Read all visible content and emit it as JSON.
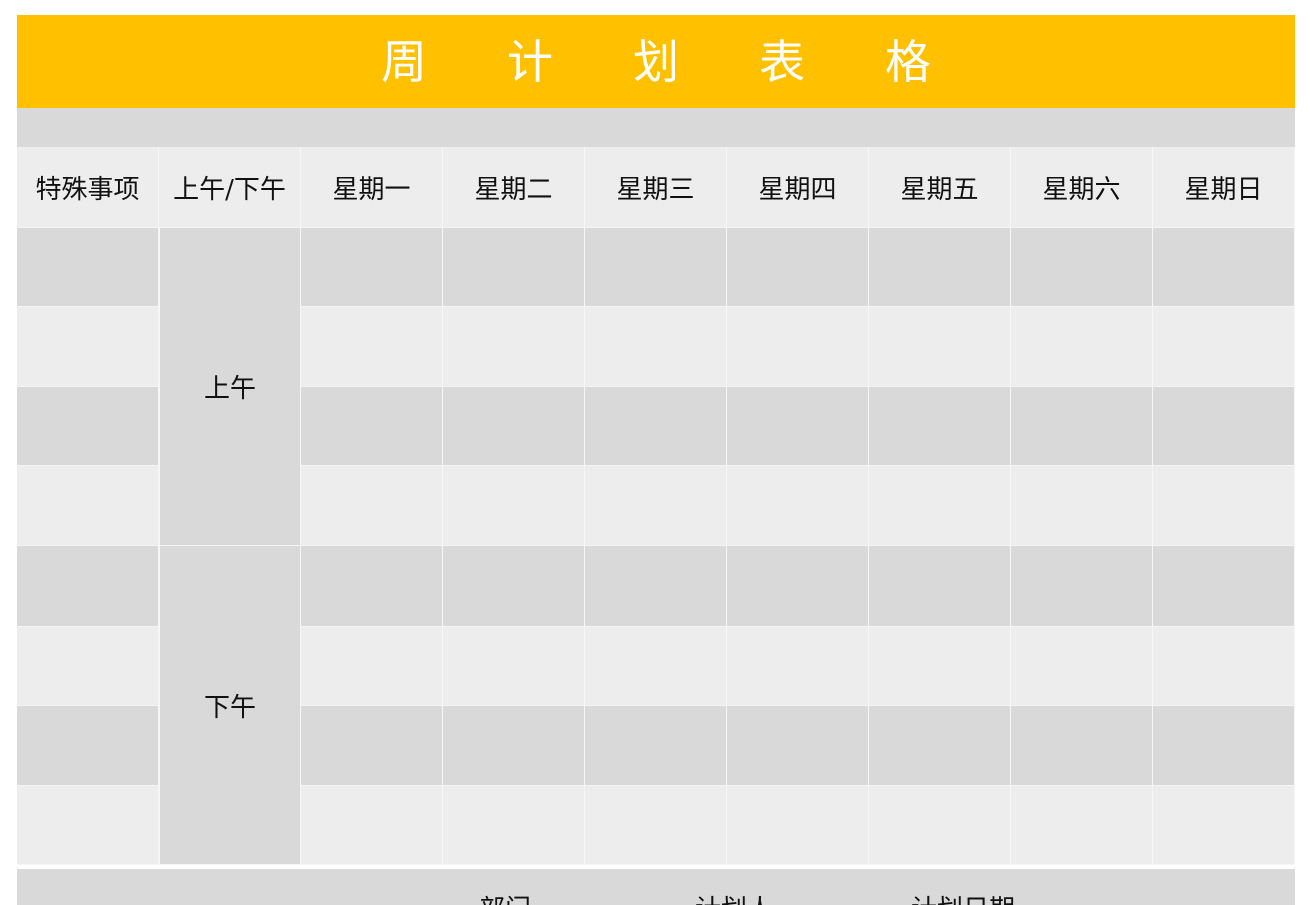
{
  "title": "周计划表格",
  "title_chars": [
    "周",
    "计",
    "划",
    "表",
    "格"
  ],
  "colors": {
    "banner": "#FFC000",
    "band_dark": "#D9D9D9",
    "band_light": "#EDEDED",
    "title_text": "#FFFFFF"
  },
  "table": {
    "headers": [
      "特殊事项",
      "上午/下午",
      "星期一",
      "星期二",
      "星期三",
      "星期四",
      "星期五",
      "星期六",
      "星期日"
    ],
    "periods": [
      "上午",
      "下午"
    ]
  },
  "footer": {
    "department_label": "部门",
    "planner_label": "计划人",
    "plan_date_label": "计划日期"
  }
}
